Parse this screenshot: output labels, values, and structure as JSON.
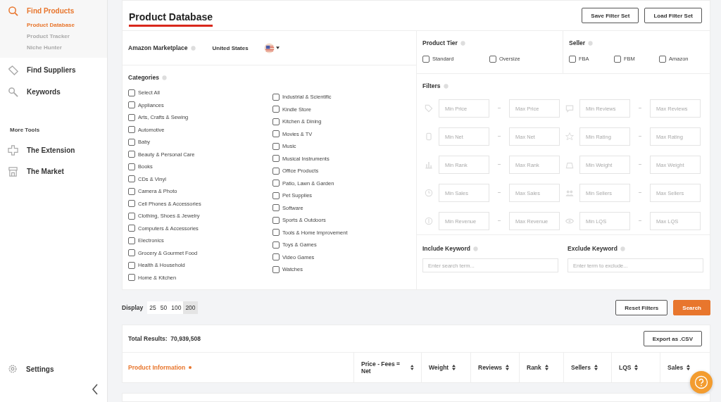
{
  "sidebar": {
    "sections": [
      {
        "label": "Find Products",
        "selected": true,
        "children": [
          {
            "label": "Product Database",
            "selected": true
          },
          {
            "label": "Product Tracker",
            "selected": false
          },
          {
            "label": "Niche Hunter",
            "selected": false
          }
        ]
      },
      {
        "label": "Find Suppliers",
        "selected": false
      },
      {
        "label": "Keywords",
        "selected": false
      }
    ],
    "more_tools_label": "More Tools",
    "more_tools": [
      {
        "label": "The Extension"
      },
      {
        "label": "The Market"
      }
    ],
    "settings": "Settings"
  },
  "header": {
    "title": "Product Database",
    "buttons": [
      "Save Filter Set",
      "Load Filter Set"
    ]
  },
  "marketplace": {
    "label": "Amazon Marketplace",
    "value": "United States"
  },
  "categories": {
    "label": "Categories",
    "columns": [
      [
        {
          "label": "Select All",
          "checked": false
        },
        {
          "label": "Appliances",
          "checked": false
        },
        {
          "label": "Arts, Crafts & Sewing",
          "checked": false
        },
        {
          "label": "Automotive",
          "checked": false
        },
        {
          "label": "Baby",
          "checked": false
        },
        {
          "label": "Beauty & Personal Care",
          "checked": false
        },
        {
          "label": "Books",
          "checked": false
        },
        {
          "label": "CDs & Vinyl",
          "checked": false
        },
        {
          "label": "Camera & Photo",
          "checked": false
        },
        {
          "label": "Cell Phones & Accessories",
          "checked": false
        },
        {
          "label": "Clothing, Shoes & Jewelry",
          "checked": false
        },
        {
          "label": "Computers & Accessories",
          "checked": false
        },
        {
          "label": "Electronics",
          "checked": false
        },
        {
          "label": "Grocery & Gourmet Food",
          "checked": false
        },
        {
          "label": "Health & Household",
          "checked": false
        },
        {
          "label": "Home & Kitchen",
          "checked": false
        }
      ],
      [
        {
          "label": "Industrial & Scientific",
          "checked": false
        },
        {
          "label": "Kindle Store",
          "checked": false
        },
        {
          "label": "Kitchen & Dining",
          "checked": false
        },
        {
          "label": "Movies & TV",
          "checked": false
        },
        {
          "label": "Music",
          "checked": false
        },
        {
          "label": "Musical Instruments",
          "checked": false
        },
        {
          "label": "Office Products",
          "checked": false
        },
        {
          "label": "Patio, Lawn & Garden",
          "checked": false
        },
        {
          "label": "Pet Supplies",
          "checked": false
        },
        {
          "label": "Software",
          "checked": false
        },
        {
          "label": "Sports & Outdoors",
          "checked": false
        },
        {
          "label": "Tools & Home Improvement",
          "checked": false
        },
        {
          "label": "Toys & Games",
          "checked": false
        },
        {
          "label": "Video Games",
          "checked": false
        },
        {
          "label": "Watches",
          "checked": false
        }
      ]
    ]
  },
  "product_tier": {
    "label": "Product Tier",
    "options": [
      {
        "label": "Standard",
        "checked": false
      },
      {
        "label": "Oversize",
        "checked": false
      }
    ]
  },
  "seller": {
    "label": "Seller",
    "options": [
      {
        "label": "FBA",
        "checked": false
      },
      {
        "label": "FBM",
        "checked": false
      },
      {
        "label": "Amazon",
        "checked": false
      }
    ]
  },
  "filters": {
    "label": "Filters",
    "rows": [
      [
        {
          "min": {
            "placeholder": "Min Price"
          },
          "max": {
            "placeholder": "Max Price"
          }
        },
        {
          "min": {
            "placeholder": "Min Reviews"
          },
          "max": {
            "placeholder": "Max Reviews"
          }
        }
      ],
      [
        {
          "min": {
            "placeholder": "Min Net"
          },
          "max": {
            "placeholder": "Max Net"
          }
        },
        {
          "min": {
            "placeholder": "Min Rating"
          },
          "max": {
            "placeholder": "Max Rating"
          }
        }
      ],
      [
        {
          "min": {
            "placeholder": "Min Rank"
          },
          "max": {
            "placeholder": "Max Rank"
          }
        },
        {
          "min": {
            "placeholder": "Min Weight"
          },
          "max": {
            "placeholder": "Max Weight"
          }
        }
      ],
      [
        {
          "min": {
            "placeholder": "Min Sales"
          },
          "max": {
            "placeholder": "Max Sales"
          }
        },
        {
          "min": {
            "placeholder": "Min Sellers"
          },
          "max": {
            "placeholder": "Max Sellers"
          }
        }
      ],
      [
        {
          "min": {
            "placeholder": "Min Revenue"
          },
          "max": {
            "placeholder": "Max Revenue"
          }
        },
        {
          "min": {
            "placeholder": "Min LQS"
          },
          "max": {
            "placeholder": "Max LQS"
          }
        }
      ]
    ]
  },
  "keywords": [
    {
      "label": "Include Keyword",
      "placeholder": "Enter search term..."
    },
    {
      "label": "Exclude Keyword",
      "placeholder": "Enter term to exclude..."
    }
  ],
  "display": {
    "label": "Display",
    "options": [
      {
        "label": "25",
        "selected": false
      },
      {
        "label": "50",
        "selected": false
      },
      {
        "label": "100",
        "selected": false
      },
      {
        "label": "200",
        "selected": true
      }
    ]
  },
  "actions": [
    {
      "label": "Reset Filters",
      "kind": "secondary"
    },
    {
      "label": "Search",
      "kind": "primary"
    }
  ],
  "results": {
    "total_label": "Total Results:",
    "total": "70,939,508",
    "export": "Export as .CSV",
    "columns": [
      {
        "label": "Product Information",
        "selected": true
      },
      {
        "label": "Price - Fees = Net",
        "selected": false
      },
      {
        "label": "Weight",
        "selected": false
      },
      {
        "label": "Reviews",
        "selected": false
      },
      {
        "label": "Rank",
        "selected": false
      },
      {
        "label": "Sellers",
        "selected": false
      },
      {
        "label": "LQS",
        "selected": false
      },
      {
        "label": "Sales",
        "selected": false
      }
    ]
  }
}
